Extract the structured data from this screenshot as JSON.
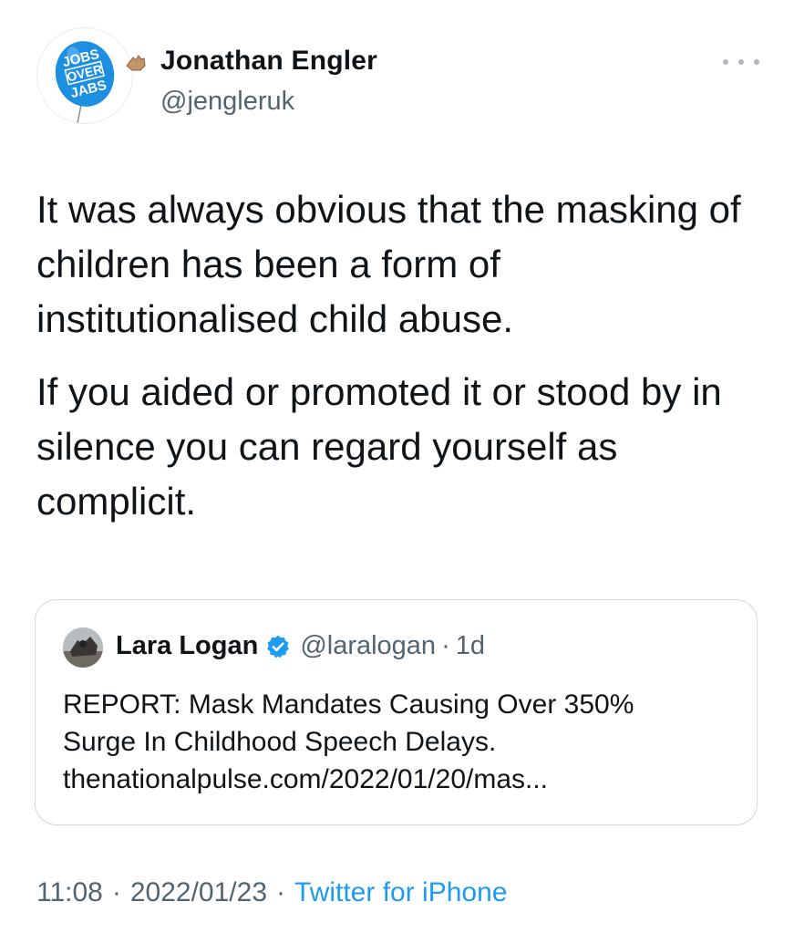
{
  "author": {
    "display_name": "Jonathan Engler",
    "handle": "@jengleruk",
    "avatar_text": [
      "JOBS",
      "OVER",
      "JABS"
    ],
    "avatar_icon": "balloon-icon",
    "badge_icon": "hand-emoji-icon"
  },
  "menu_icon": "more-options-icon",
  "tweet": {
    "paragraphs": [
      "It was always obvious that the masking of children has been a form of institutionalised child abuse.",
      "If you aided or promoted it or stood by in silence you can regard yourself as complicit."
    ]
  },
  "quote": {
    "display_name": "Lara Logan",
    "verified_icon": "verified-badge-icon",
    "handle": "@laralogan",
    "separator": "·",
    "time": "1d",
    "lines": [
      "REPORT: Mask Mandates Causing Over 350%",
      "Surge In Childhood Speech Delays.",
      "thenationalpulse.com/2022/01/20/mas..."
    ]
  },
  "footer": {
    "time": "11:08",
    "separator": "·",
    "date": "2022/01/23",
    "source": "Twitter for iPhone"
  },
  "colors": {
    "text_primary": "#0f1419",
    "text_secondary": "#536471",
    "accent": "#1d9bf0",
    "avatar_balloon": "#1d8fe0",
    "border": "#cfd9de"
  }
}
